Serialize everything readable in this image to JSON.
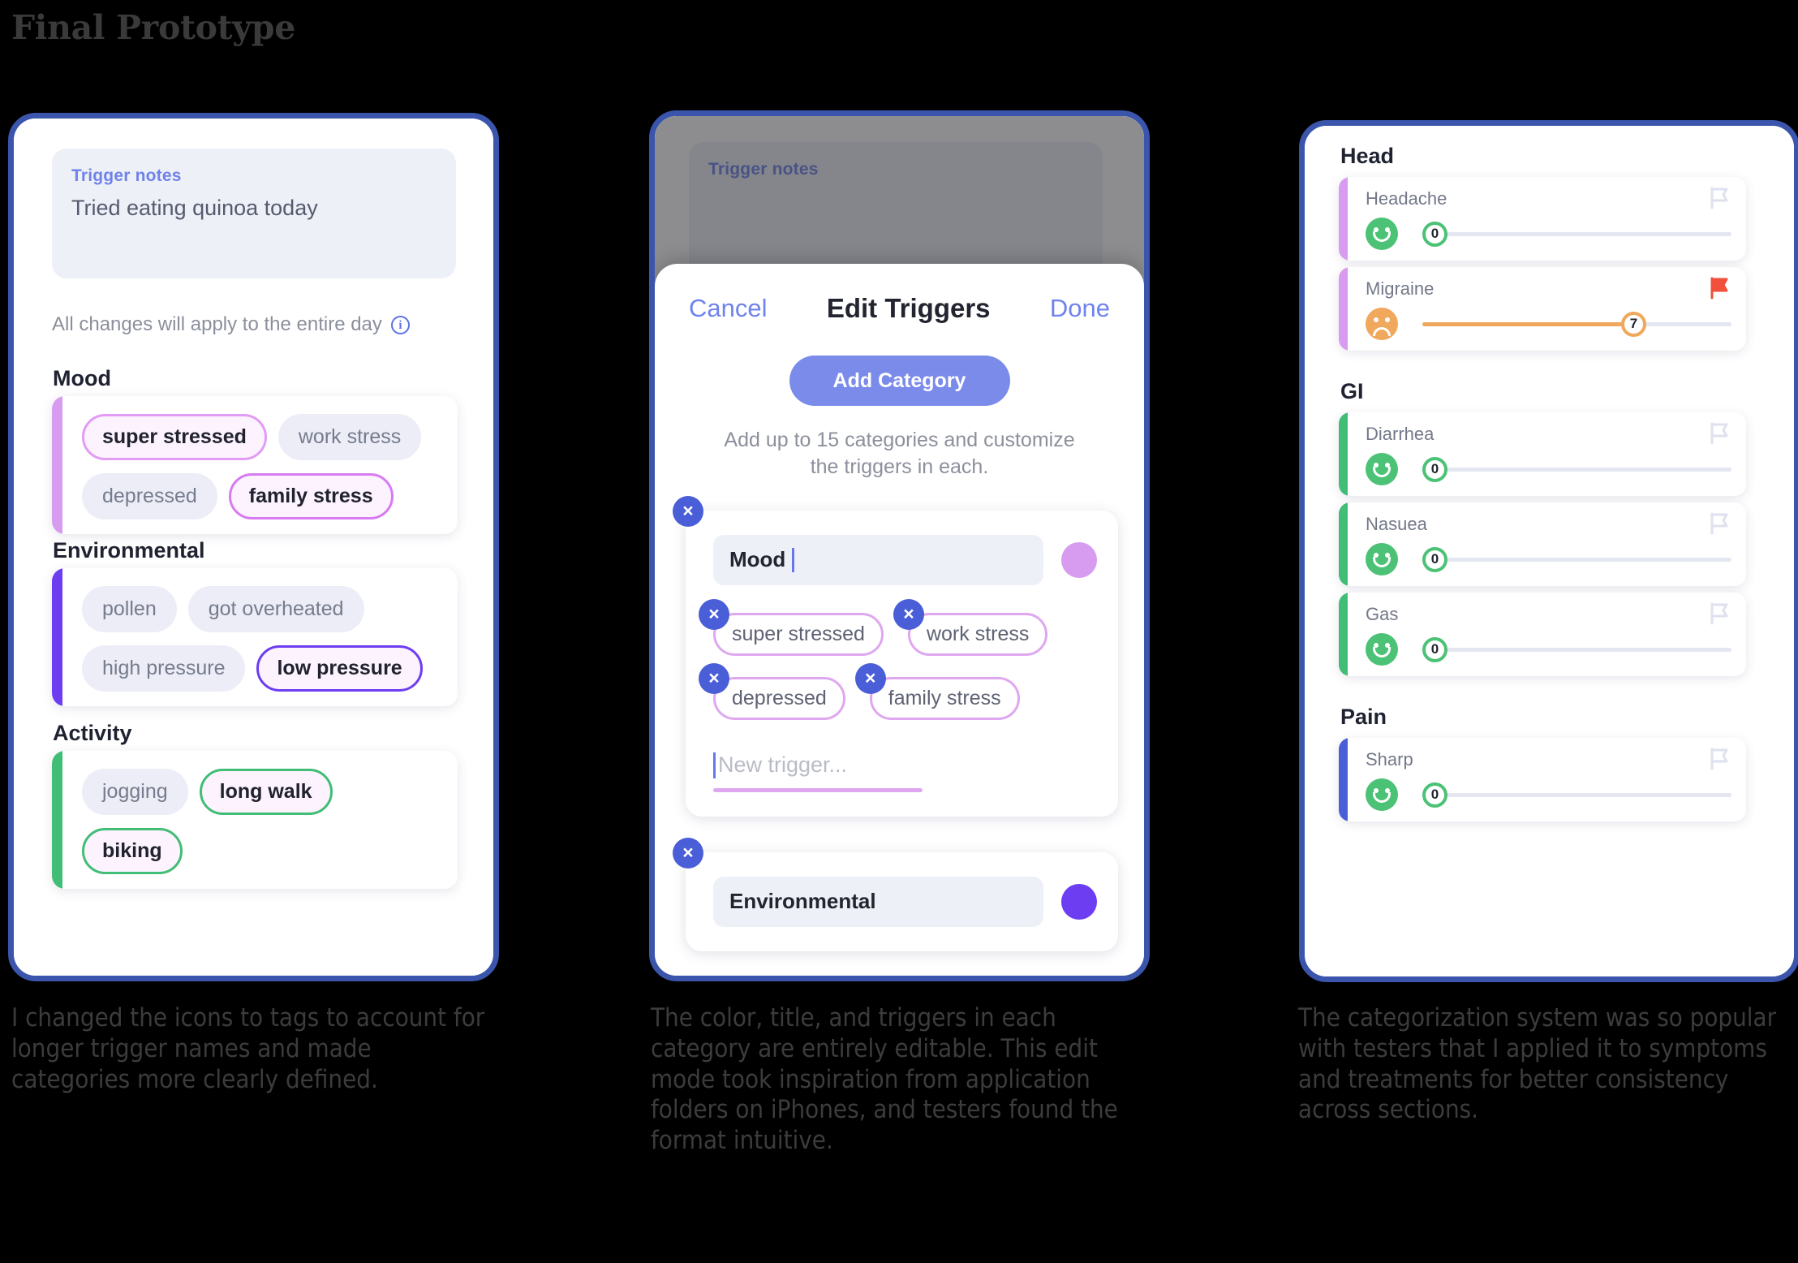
{
  "page": {
    "title": "Final Prototype"
  },
  "screen1": {
    "notes": {
      "label": "Trigger notes",
      "value": "Tried eating quinoa today"
    },
    "apply_note": "All changes will apply to the entire day",
    "info_icon": "info-icon",
    "categories": [
      {
        "name": "Mood",
        "accent": "#d79bf0",
        "tags": [
          {
            "label": "super stressed",
            "selected": true,
            "border": "#e29cf5"
          },
          {
            "label": "work stress",
            "selected": false,
            "border": ""
          },
          {
            "label": "depressed",
            "selected": false,
            "border": ""
          },
          {
            "label": "family stress",
            "selected": true,
            "border": "#d77bf0"
          }
        ]
      },
      {
        "name": "Environmental",
        "accent": "#6d3df2",
        "tags": [
          {
            "label": "pollen",
            "selected": false,
            "border": ""
          },
          {
            "label": "got overheated",
            "selected": false,
            "border": ""
          },
          {
            "label": "high pressure",
            "selected": false,
            "border": ""
          },
          {
            "label": "low pressure",
            "selected": true,
            "border": "#6d3df2"
          }
        ]
      },
      {
        "name": "Activity",
        "accent": "#41bd76",
        "tags": [
          {
            "label": "jogging",
            "selected": false,
            "border": ""
          },
          {
            "label": "long walk",
            "selected": true,
            "border": "#41bd76"
          },
          {
            "label": "biking",
            "selected": true,
            "border": "#41bd76"
          }
        ]
      }
    ]
  },
  "screen2": {
    "background_notes_label": "Trigger notes",
    "modal": {
      "cancel": "Cancel",
      "title": "Edit Triggers",
      "done": "Done",
      "add_category_button": "Add Category",
      "subtitle": "Add up to 15 categories and customize the triggers in each.",
      "close_icon": "close-icon",
      "categories": [
        {
          "name": "Mood",
          "swatch": "#d79bf0",
          "triggers": [
            "super stressed",
            "work stress",
            "depressed",
            "family stress"
          ],
          "new_trigger_placeholder": "New trigger..."
        },
        {
          "name": "Environmental",
          "swatch": "#6d3df2",
          "triggers": [],
          "new_trigger_placeholder": ""
        }
      ]
    }
  },
  "screen3": {
    "sections": [
      {
        "name": "Head",
        "accent": "#d79bf0",
        "symptoms": [
          {
            "name": "Headache",
            "value": "0",
            "mood": "happy",
            "flagged": false
          },
          {
            "name": "Migraine",
            "value": "7",
            "mood": "sad",
            "flagged": true
          }
        ]
      },
      {
        "name": "GI",
        "accent": "#41bd76",
        "symptoms": [
          {
            "name": "Diarrhea",
            "value": "0",
            "mood": "happy",
            "flagged": false
          },
          {
            "name": "Nasuea",
            "value": "0",
            "mood": "happy",
            "flagged": false
          },
          {
            "name": "Gas",
            "value": "0",
            "mood": "happy",
            "flagged": false
          }
        ]
      },
      {
        "name": "Pain",
        "accent": "#4a5ed8",
        "symptoms": [
          {
            "name": "Sharp",
            "value": "0",
            "mood": "happy",
            "flagged": false
          }
        ]
      }
    ],
    "colors": {
      "happy": "#4cc276",
      "sad": "#f0a85c",
      "flag_on": "#f0503c",
      "flag_off": "#dfe2ee"
    }
  },
  "captions": {
    "one": "I changed the icons to tags to account for longer trigger names and made categories more clearly defined.",
    "two": "The color, title, and triggers in each category are entirely editable. This edit mode took inspiration from application folders on iPhones, and testers found the format intuitive.",
    "three": "The categorization system was so popular with testers that I applied it to symptoms and treatments for better consistency across sections."
  }
}
